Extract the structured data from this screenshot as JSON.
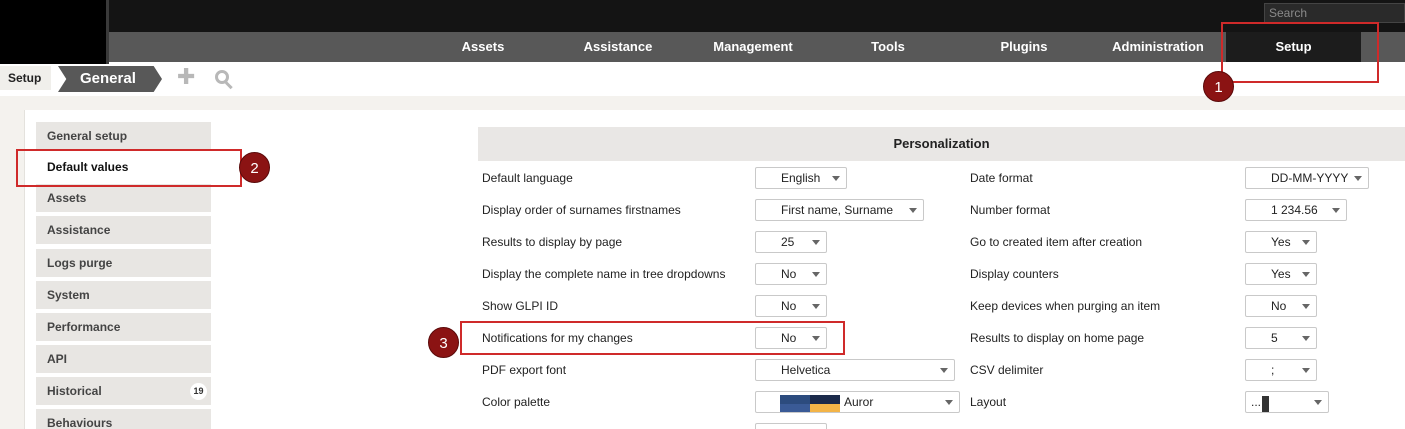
{
  "header": {
    "search_placeholder": "Search"
  },
  "nav": {
    "items": [
      {
        "label": "Assets"
      },
      {
        "label": "Assistance"
      },
      {
        "label": "Management"
      },
      {
        "label": "Tools"
      },
      {
        "label": "Plugins"
      },
      {
        "label": "Administration"
      },
      {
        "label": "Setup"
      }
    ],
    "active": "Setup"
  },
  "breadcrumb": {
    "root": "Setup",
    "current": "General",
    "add_icon": "plus-icon",
    "search_icon": "magnifier-icon"
  },
  "tabs": [
    {
      "label": "General setup"
    },
    {
      "label": "Default values"
    },
    {
      "label": "Assets"
    },
    {
      "label": "Assistance"
    },
    {
      "label": "Logs purge"
    },
    {
      "label": "System"
    },
    {
      "label": "Performance"
    },
    {
      "label": "API"
    },
    {
      "label": "Historical",
      "badge": "19"
    },
    {
      "label": "Behaviours"
    }
  ],
  "section": {
    "title": "Personalization"
  },
  "fields": {
    "left": [
      {
        "label": "Default language",
        "value": "English"
      },
      {
        "label": "Display order of surnames firstnames",
        "value": "First name, Surname"
      },
      {
        "label": "Results to display by page",
        "value": "25"
      },
      {
        "label": "Display the complete name in tree dropdowns",
        "value": "No"
      },
      {
        "label": "Show GLPI ID",
        "value": "No"
      },
      {
        "label": "Notifications for my changes",
        "value": "No"
      },
      {
        "label": "PDF export font",
        "value": "Helvetica"
      },
      {
        "label": "Color palette",
        "value": "Auror"
      }
    ],
    "right": [
      {
        "label": "Date format",
        "value": "DD-MM-YYYY"
      },
      {
        "label": "Number format",
        "value": "1 234.56"
      },
      {
        "label": "Go to created item after creation",
        "value": "Yes"
      },
      {
        "label": "Display counters",
        "value": "Yes"
      },
      {
        "label": "Keep devices when purging an item",
        "value": "No"
      },
      {
        "label": "Results to display on home page",
        "value": "5"
      },
      {
        "label": "CSV delimiter",
        "value": ";"
      },
      {
        "label": "Layout",
        "value": "..."
      }
    ]
  },
  "palette_colors": [
    "#2c4b7e",
    "#1b2a4a",
    "#3a5a96",
    "#f3b447"
  ],
  "annotations": {
    "color": "#cf2a2a",
    "marker_color": "#8b1313",
    "markers": [
      "1",
      "2",
      "3"
    ]
  }
}
